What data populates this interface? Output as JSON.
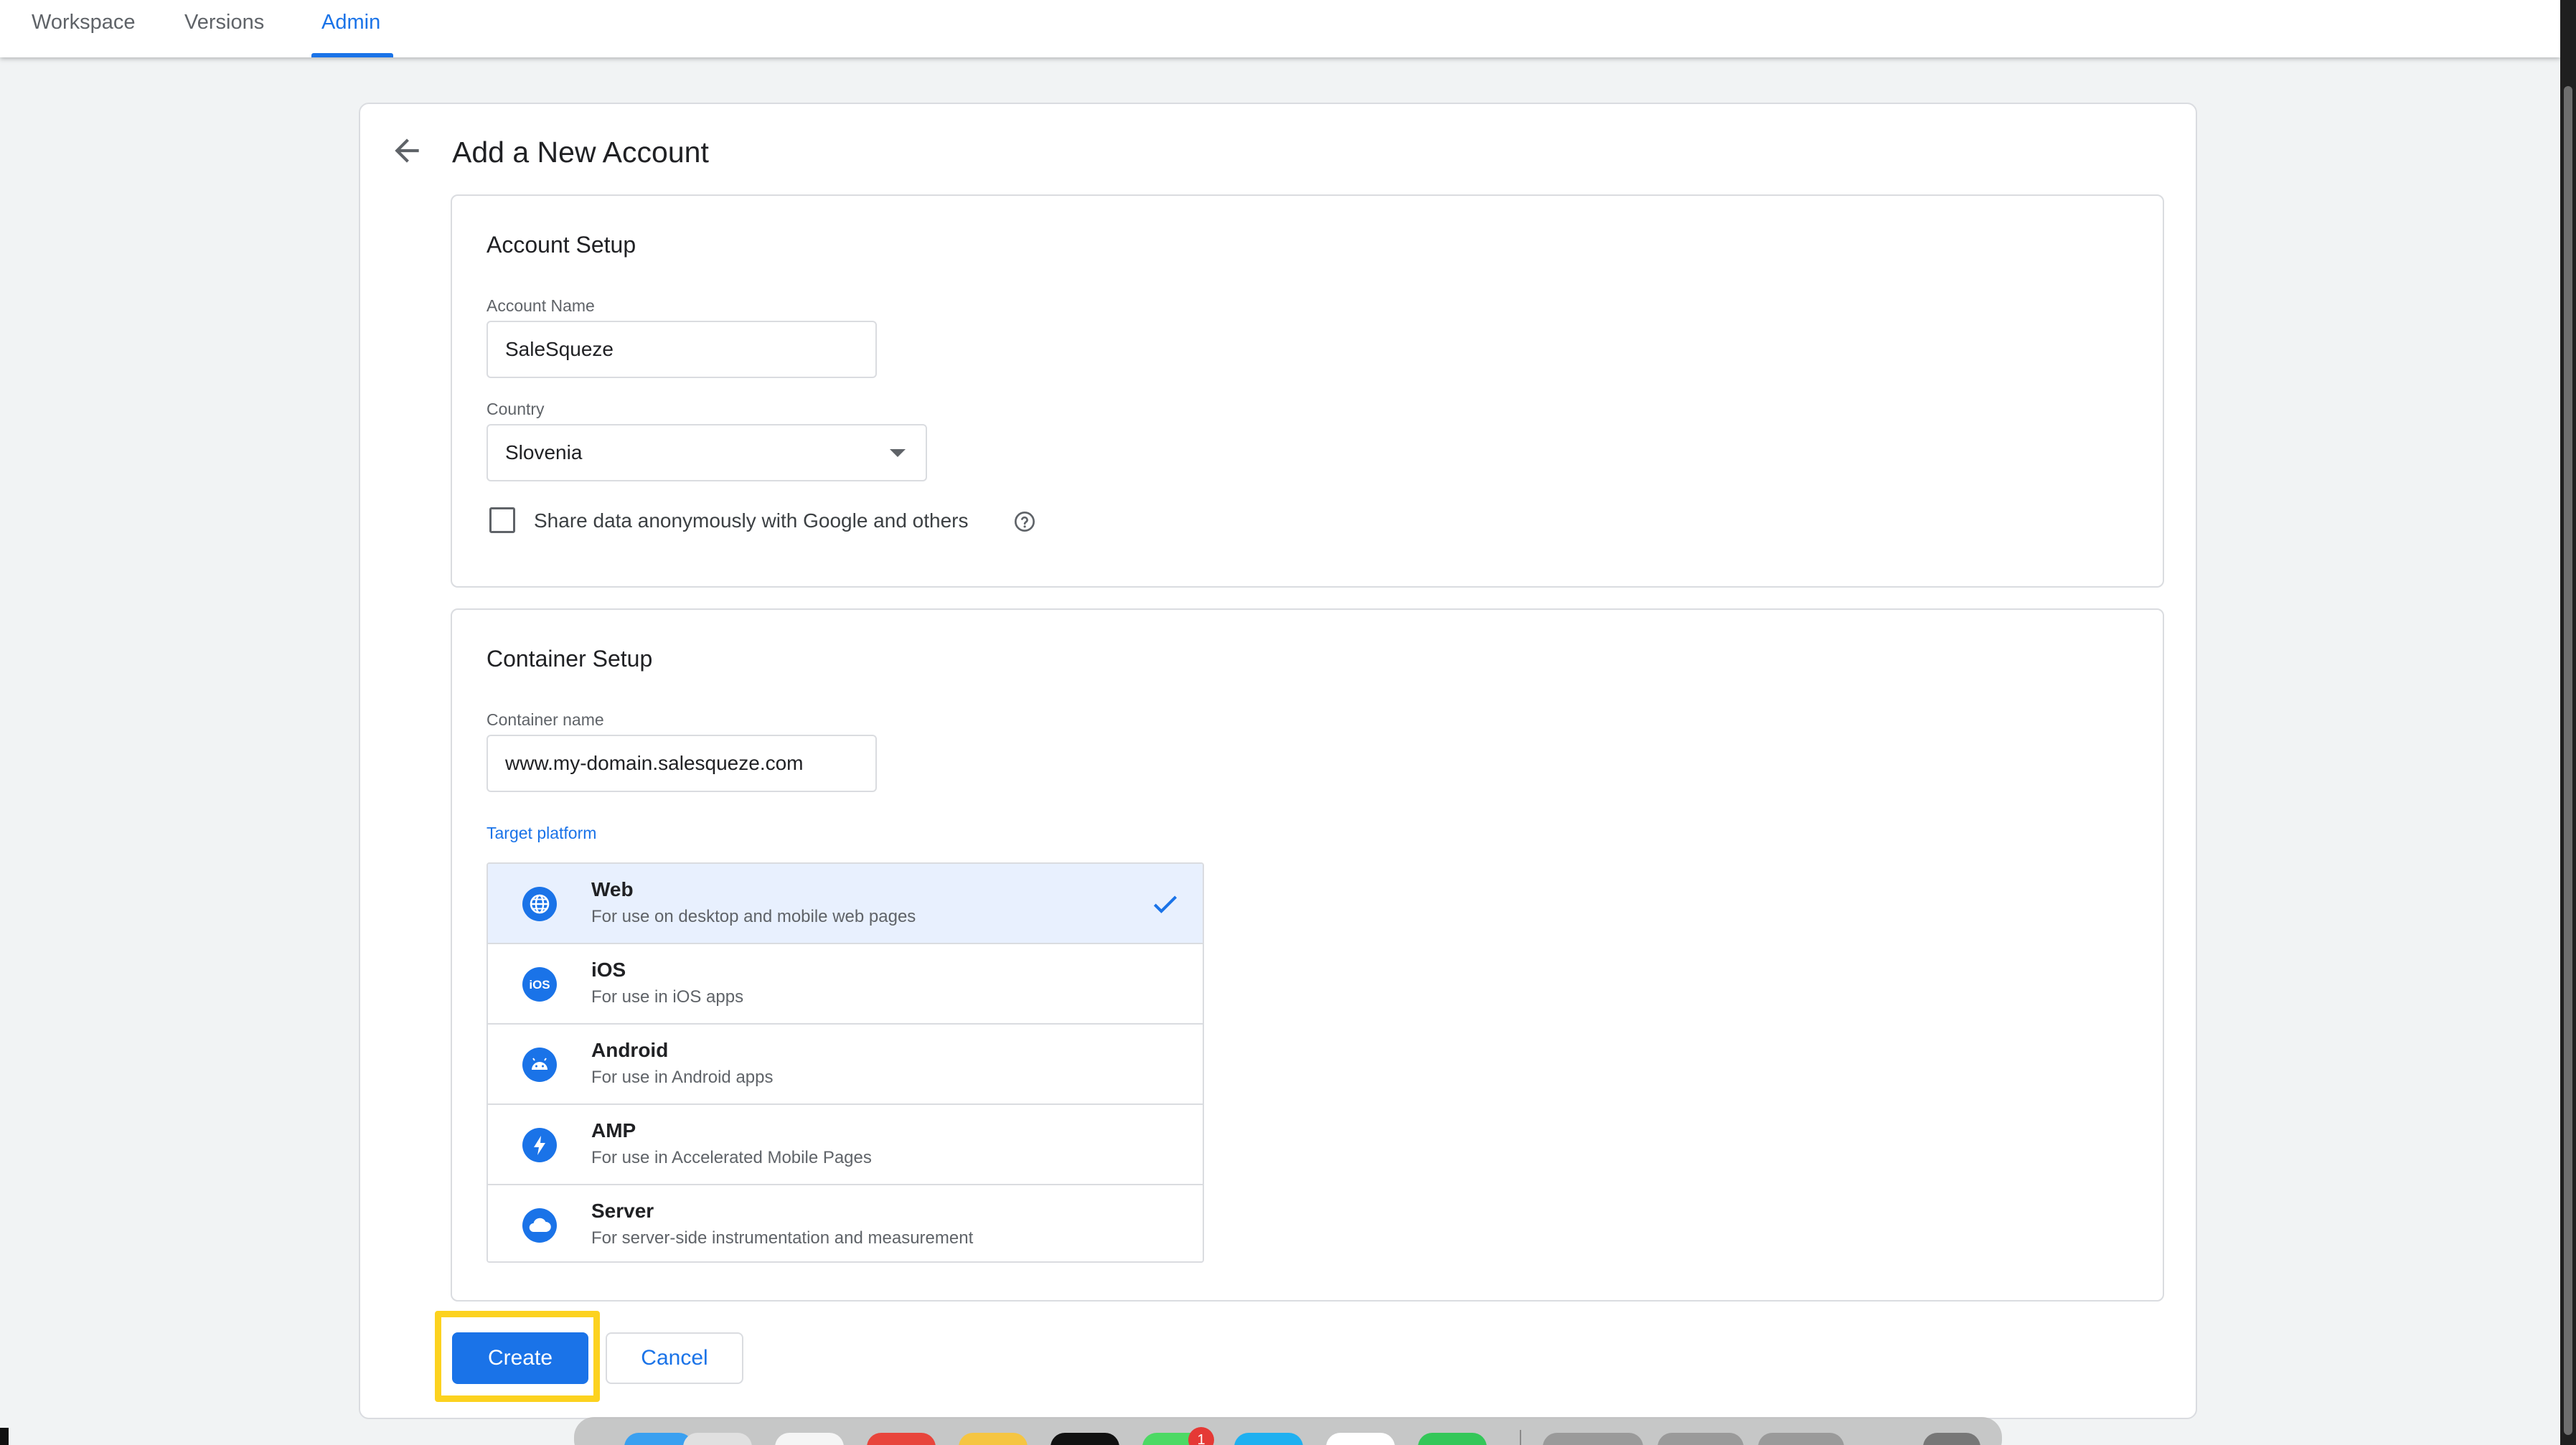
{
  "nav": {
    "tabs": [
      {
        "label": "Workspace",
        "active": false
      },
      {
        "label": "Versions",
        "active": false
      },
      {
        "label": "Admin",
        "active": true
      }
    ]
  },
  "page": {
    "title": "Add a New Account",
    "back_icon": "arrow-back-icon"
  },
  "account_setup": {
    "title": "Account Setup",
    "account_name_label": "Account Name",
    "account_name_value": "SaleSqueze",
    "country_label": "Country",
    "country_value": "Slovenia",
    "share_data_label": "Share data anonymously with Google and others",
    "share_data_checked": false,
    "help_icon": "help-circle-icon"
  },
  "container_setup": {
    "title": "Container Setup",
    "container_name_label": "Container name",
    "container_name_value": "www.my-domain.salesqueze.com",
    "target_platform_label": "Target platform",
    "platforms": [
      {
        "name": "Web",
        "description": "For use on desktop and mobile web pages",
        "icon": "globe-icon",
        "selected": true
      },
      {
        "name": "iOS",
        "description": "For use in iOS apps",
        "icon": "ios-icon",
        "selected": false
      },
      {
        "name": "Android",
        "description": "For use in Android apps",
        "icon": "android-icon",
        "selected": false
      },
      {
        "name": "AMP",
        "description": "For use in Accelerated Mobile Pages",
        "icon": "amp-bolt-icon",
        "selected": false
      },
      {
        "name": "Server",
        "description": "For server-side instrumentation and measurement",
        "icon": "cloud-icon",
        "selected": false
      }
    ]
  },
  "actions": {
    "create_label": "Create",
    "cancel_label": "Cancel"
  },
  "colors": {
    "accent": "#1a73e8",
    "highlight": "#fcd21f",
    "selected_row": "#e8f0fe"
  },
  "dock": {
    "badge_count": "1"
  }
}
